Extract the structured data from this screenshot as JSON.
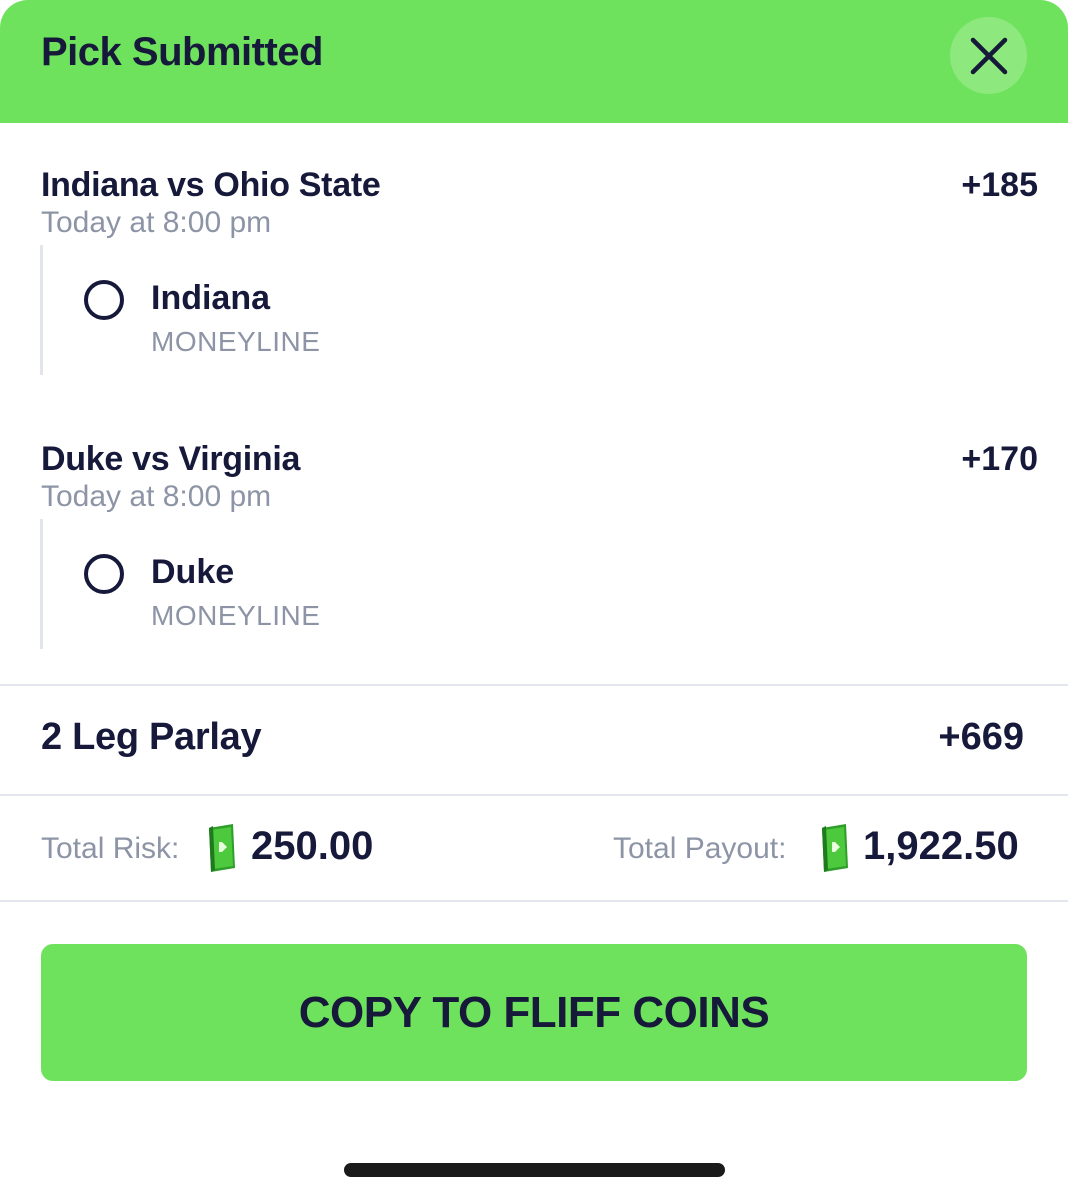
{
  "header": {
    "title": "Pick Submitted"
  },
  "legs": [
    {
      "game": "Indiana vs Ohio State",
      "time": "Today at 8:00 pm",
      "odds": "+185",
      "pick": "Indiana",
      "market": "MONEYLINE"
    },
    {
      "game": "Duke vs Virginia",
      "time": "Today at 8:00 pm",
      "odds": "+170",
      "pick": "Duke",
      "market": "MONEYLINE"
    }
  ],
  "parlay": {
    "label": "2 Leg Parlay",
    "odds": "+669"
  },
  "totals": {
    "risk_label": "Total Risk:",
    "risk_value": "250.00",
    "payout_label": "Total Payout:",
    "payout_value": "1,922.50"
  },
  "button": {
    "label": "COPY TO FLIFF COINS"
  },
  "colors": {
    "accent_green": "#6fe25d",
    "text_dark": "#16193a",
    "text_muted": "#8d94a5"
  },
  "icons": {
    "close": "close-icon",
    "cash": "cash-icon",
    "radio": "radio-unselected-icon"
  }
}
